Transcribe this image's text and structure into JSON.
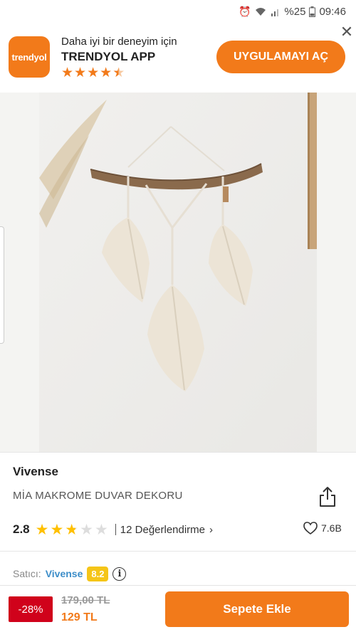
{
  "status_bar": {
    "battery": "%25",
    "time": "09:46",
    "icons": [
      "alarm-icon",
      "wifi-icon",
      "signal-icon",
      "battery-icon"
    ]
  },
  "app_banner": {
    "logo_text": "trendyol",
    "tagline": "Daha iyi bir deneyim için",
    "app_name": "TRENDYOL APP",
    "rating_stars": 4.5,
    "open_button": "UYGULAMAYI AÇ",
    "close_icon": "close-icon"
  },
  "product": {
    "brand": "Vivense",
    "name": "MİA MAKROME DUVAR DEKORU",
    "rating": "2.8",
    "rating_stars": 2.8,
    "review_count": "12",
    "review_label": "Değerlendirme",
    "favorites": "7.6B",
    "seller_label": "Satıcı:",
    "seller_name": "Vivense",
    "seller_score": "8.2"
  },
  "price": {
    "discount": "-28%",
    "old_price": "179,00 TL",
    "new_price": "129 TL"
  },
  "actions": {
    "add_to_cart": "Sepete Ekle"
  },
  "colors": {
    "brand_orange": "#f27a1a",
    "discount_red": "#d0021b",
    "star_yellow": "#ffc000",
    "seller_score_bg": "#f5c518",
    "seller_link": "#3d8ec9"
  }
}
